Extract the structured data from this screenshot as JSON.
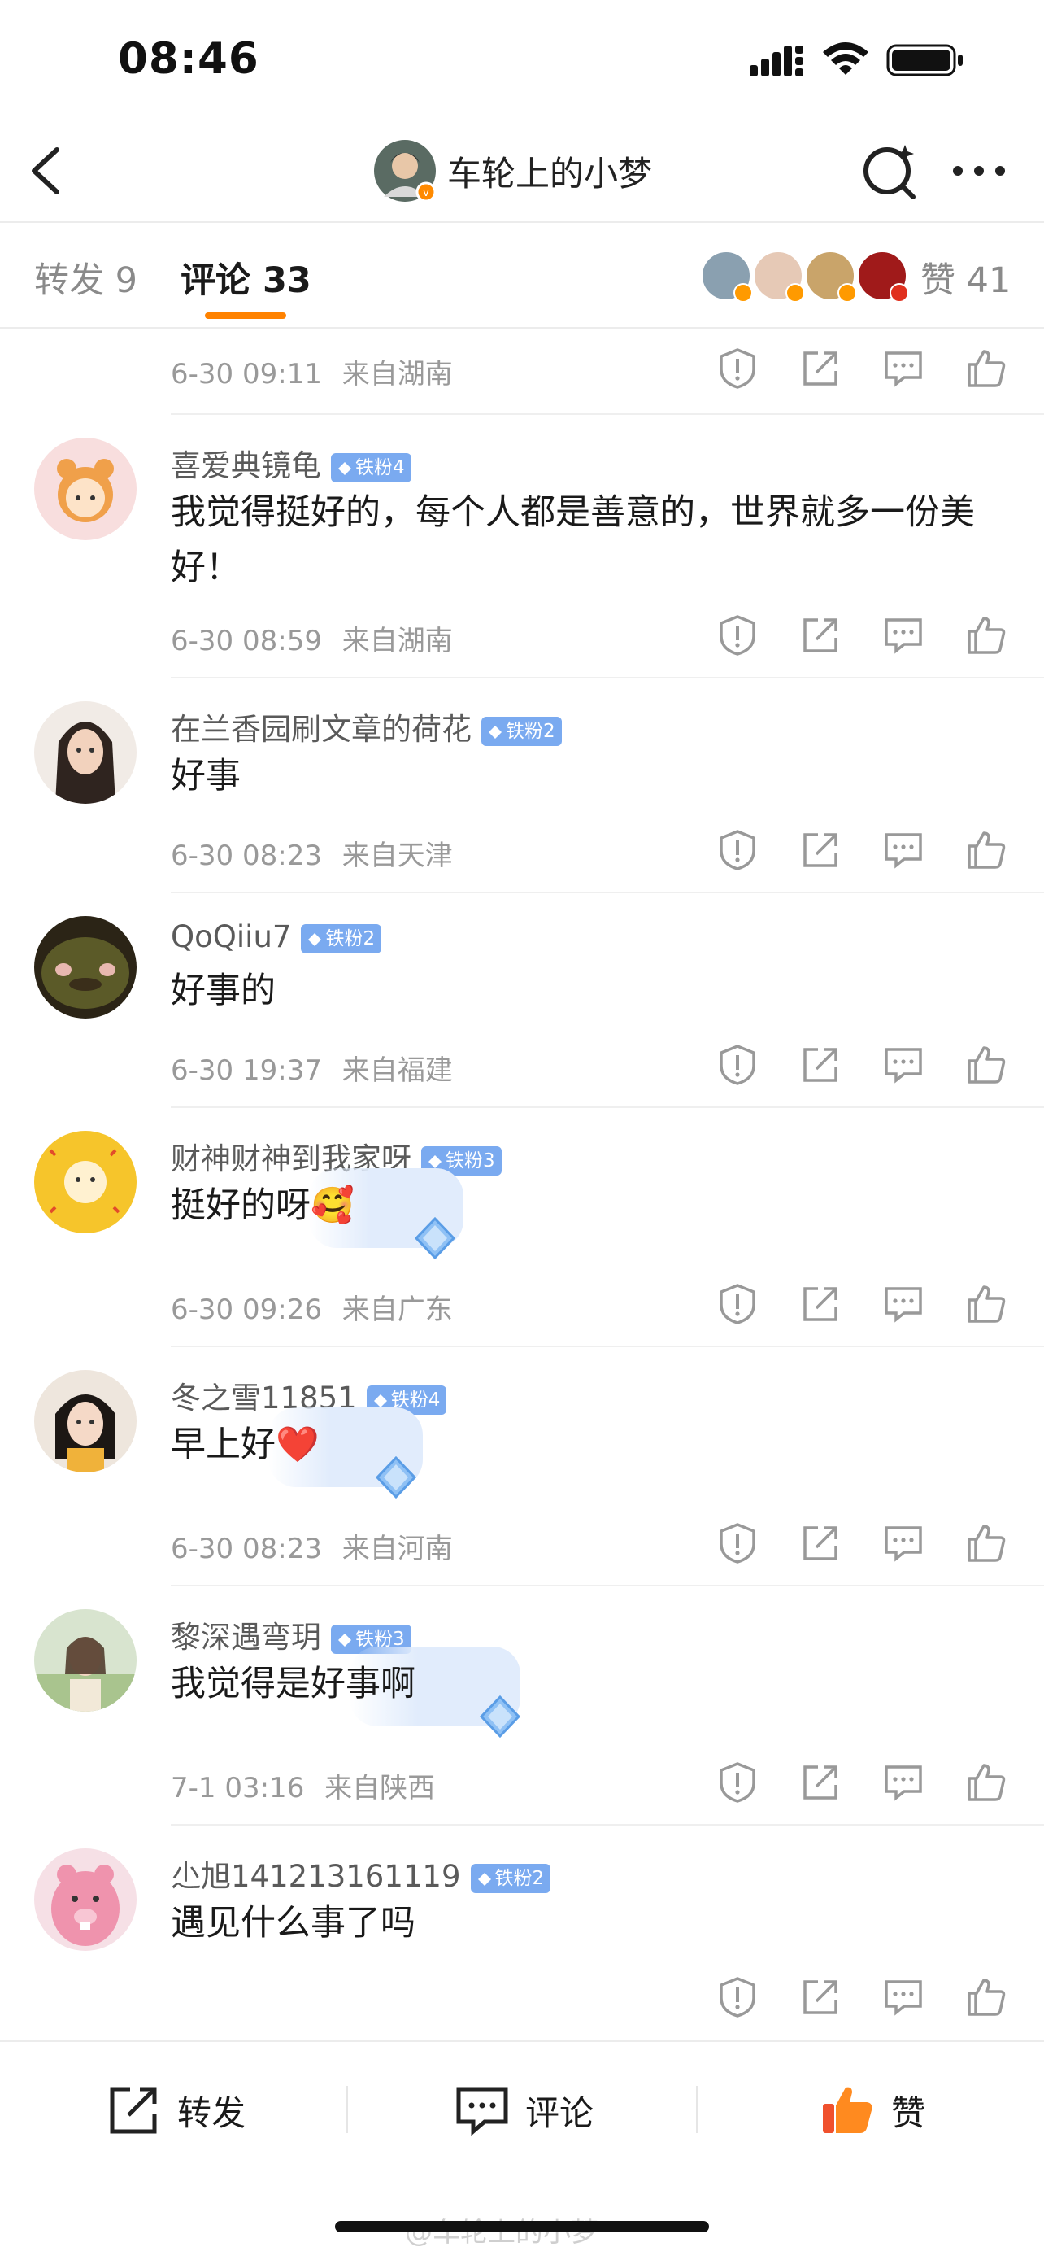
{
  "status_bar": {
    "time": "08:46"
  },
  "nav": {
    "title": "车轮上的小梦"
  },
  "tabs": {
    "repost": "转发 9",
    "comment": "评论 33",
    "likes": "赞 41"
  },
  "first_meta": {
    "time": "6-30 09:11",
    "location": "来自湖南"
  },
  "comments": [
    {
      "name": "喜爱典镜龟",
      "fan_level": "铁粉4",
      "text": "我觉得挺好的，每个人都是善意的，世界就多一份美好！",
      "time": "6-30 08:59",
      "location": "来自湖南"
    },
    {
      "name": "在兰香园刷文章的荷花",
      "fan_level": "铁粉2",
      "text": "好事",
      "time": "6-30 08:23",
      "location": "来自天津"
    },
    {
      "name": "QoQiiu7",
      "fan_level": "铁粉2",
      "text": "好事的",
      "time": "6-30 19:37",
      "location": "来自福建"
    },
    {
      "name": "财神财神到我家呀",
      "fan_level": "铁粉3",
      "text": "挺好的呀",
      "emoji": "🥰",
      "time": "6-30 09:26",
      "location": "来自广东"
    },
    {
      "name": "冬之雪11851",
      "fan_level": "铁粉4",
      "text": "早上好",
      "emoji": "❤️",
      "time": "6-30 08:23",
      "location": "来自河南"
    },
    {
      "name": "黎深遇弯玥",
      "fan_level": "铁粉3",
      "text": "我觉得是好事啊",
      "time": "7-1 03:16",
      "location": "来自陕西"
    },
    {
      "name": "尐旭141213161119",
      "fan_level": "铁粉2",
      "text": "遇见什么事了吗",
      "time": "",
      "location": ""
    }
  ],
  "bottom_bar": {
    "repost": "转发",
    "comment": "评论",
    "like": "赞"
  },
  "watermark": "@车轮上的小梦",
  "colors": {
    "accent": "#ff8200",
    "fan_badge": "#7aaaf0",
    "meta": "#999999"
  },
  "icons": {
    "report": "shield-exclamation-icon",
    "share": "share-box-icon",
    "reply": "comment-bubble-icon",
    "like": "thumbs-up-icon"
  }
}
